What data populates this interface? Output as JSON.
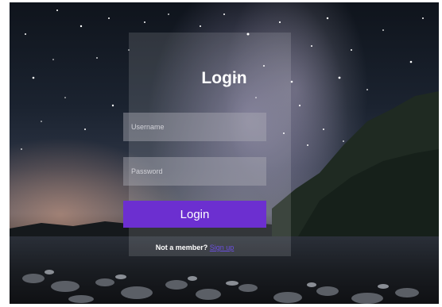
{
  "login": {
    "title": "Login",
    "username_placeholder": "Username",
    "password_placeholder": "Password",
    "button_label": "Login",
    "member_prompt": "Not a member?",
    "signup_link": "Sign up"
  },
  "colors": {
    "accent": "#6c2fd0",
    "link": "#6b4fe0"
  }
}
